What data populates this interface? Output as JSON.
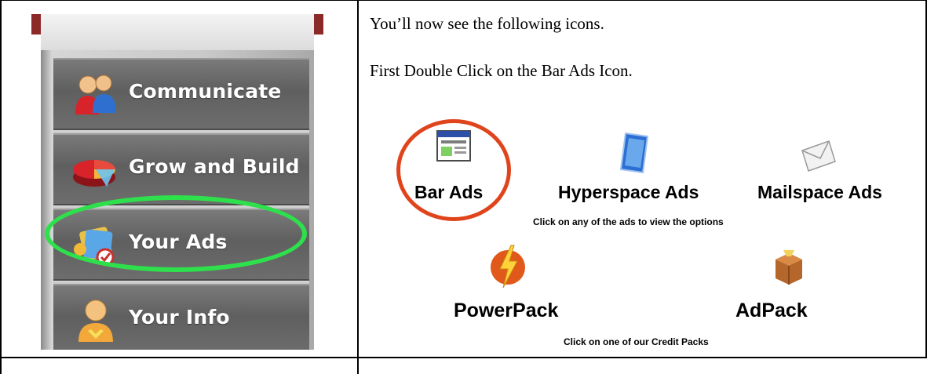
{
  "left_panel": {
    "menu_items": [
      {
        "label": "Communicate",
        "icon": "people-icon"
      },
      {
        "label": "Grow and Build",
        "icon": "pie-chart-icon"
      },
      {
        "label": "Your Ads",
        "icon": "ads-folder-icon"
      },
      {
        "label": "Your Info",
        "icon": "person-icon"
      }
    ],
    "highlighted_item": "Your Ads",
    "highlight_color": "#2ee04c"
  },
  "right_panel": {
    "intro_text": "You’ll now see the following icons.",
    "instruction_text": "First Double Click on the Bar Ads Icon.",
    "ads": [
      {
        "label": "Bar Ads",
        "icon": "browser-window-icon"
      },
      {
        "label": "Hyperspace Ads",
        "icon": "blue-panel-icon"
      },
      {
        "label": "Mailspace Ads",
        "icon": "envelope-icon"
      }
    ],
    "ads_note": "Click on any of the ads to view the options",
    "packs": [
      {
        "label": "PowerPack",
        "icon": "lightning-icon"
      },
      {
        "label": "AdPack",
        "icon": "package-box-icon"
      }
    ],
    "packs_note": "Click on one of our Credit Packs",
    "highlighted_ad": "Bar Ads",
    "highlight_color": "#e0441c"
  }
}
